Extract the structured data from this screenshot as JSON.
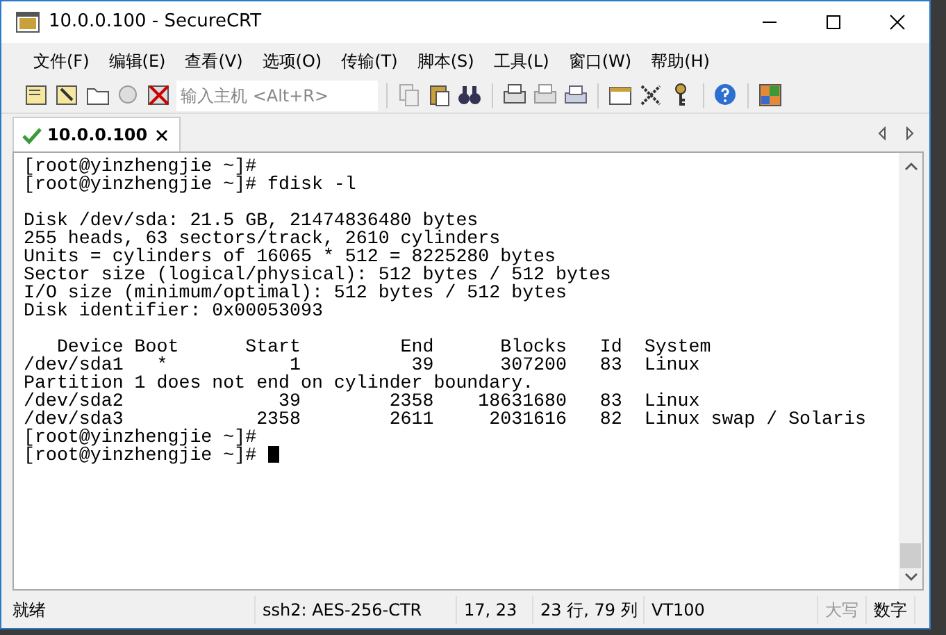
{
  "window": {
    "title": "10.0.0.100 - SecureCRT"
  },
  "menu": [
    "文件(F)",
    "编辑(E)",
    "查看(V)",
    "选项(O)",
    "传输(T)",
    "脚本(S)",
    "工具(L)",
    "窗口(W)",
    "帮助(H)"
  ],
  "toolbar": {
    "host_field": {
      "placeholder": "输入主机 <Alt+R>"
    }
  },
  "tabs": [
    {
      "label": "10.0.0.100",
      "selected": true,
      "connected": true
    }
  ],
  "terminal": {
    "blocks": [
      {
        "lines": [
          "[root@yinzhengjie ~]#",
          "[root@yinzhengjie ~]# fdisk -l"
        ]
      },
      {
        "lines": [
          "Disk /dev/sda: 21.5 GB, 21474836480 bytes",
          "255 heads, 63 sectors/track, 2610 cylinders",
          "Units = cylinders of 16065 * 512 = 8225280 bytes",
          "Sector size (logical/physical): 512 bytes / 512 bytes",
          "I/O size (minimum/optimal): 512 bytes / 512 bytes",
          "Disk identifier: 0x00053093"
        ]
      },
      {
        "lines": [
          "   Device Boot      Start         End      Blocks   Id  System",
          "/dev/sda1   *           1          39      307200   83  Linux",
          "Partition 1 does not end on cylinder boundary.",
          "/dev/sda2              39        2358    18631680   83  Linux",
          "/dev/sda3            2358        2611     2031616   82  Linux swap / Solaris",
          "[root@yinzhengjie ~]#",
          "[root@yinzhengjie ~]# "
        ]
      }
    ]
  },
  "status_bar": {
    "ready": "就绪",
    "protocol": "ssh2: AES-256-CTR",
    "cursor": "17,  23",
    "size": "23 行, 79 列",
    "emulation": "VT100",
    "indicators": [
      {
        "label": "大写",
        "active": false
      },
      {
        "label": "数字",
        "active": true
      }
    ]
  }
}
